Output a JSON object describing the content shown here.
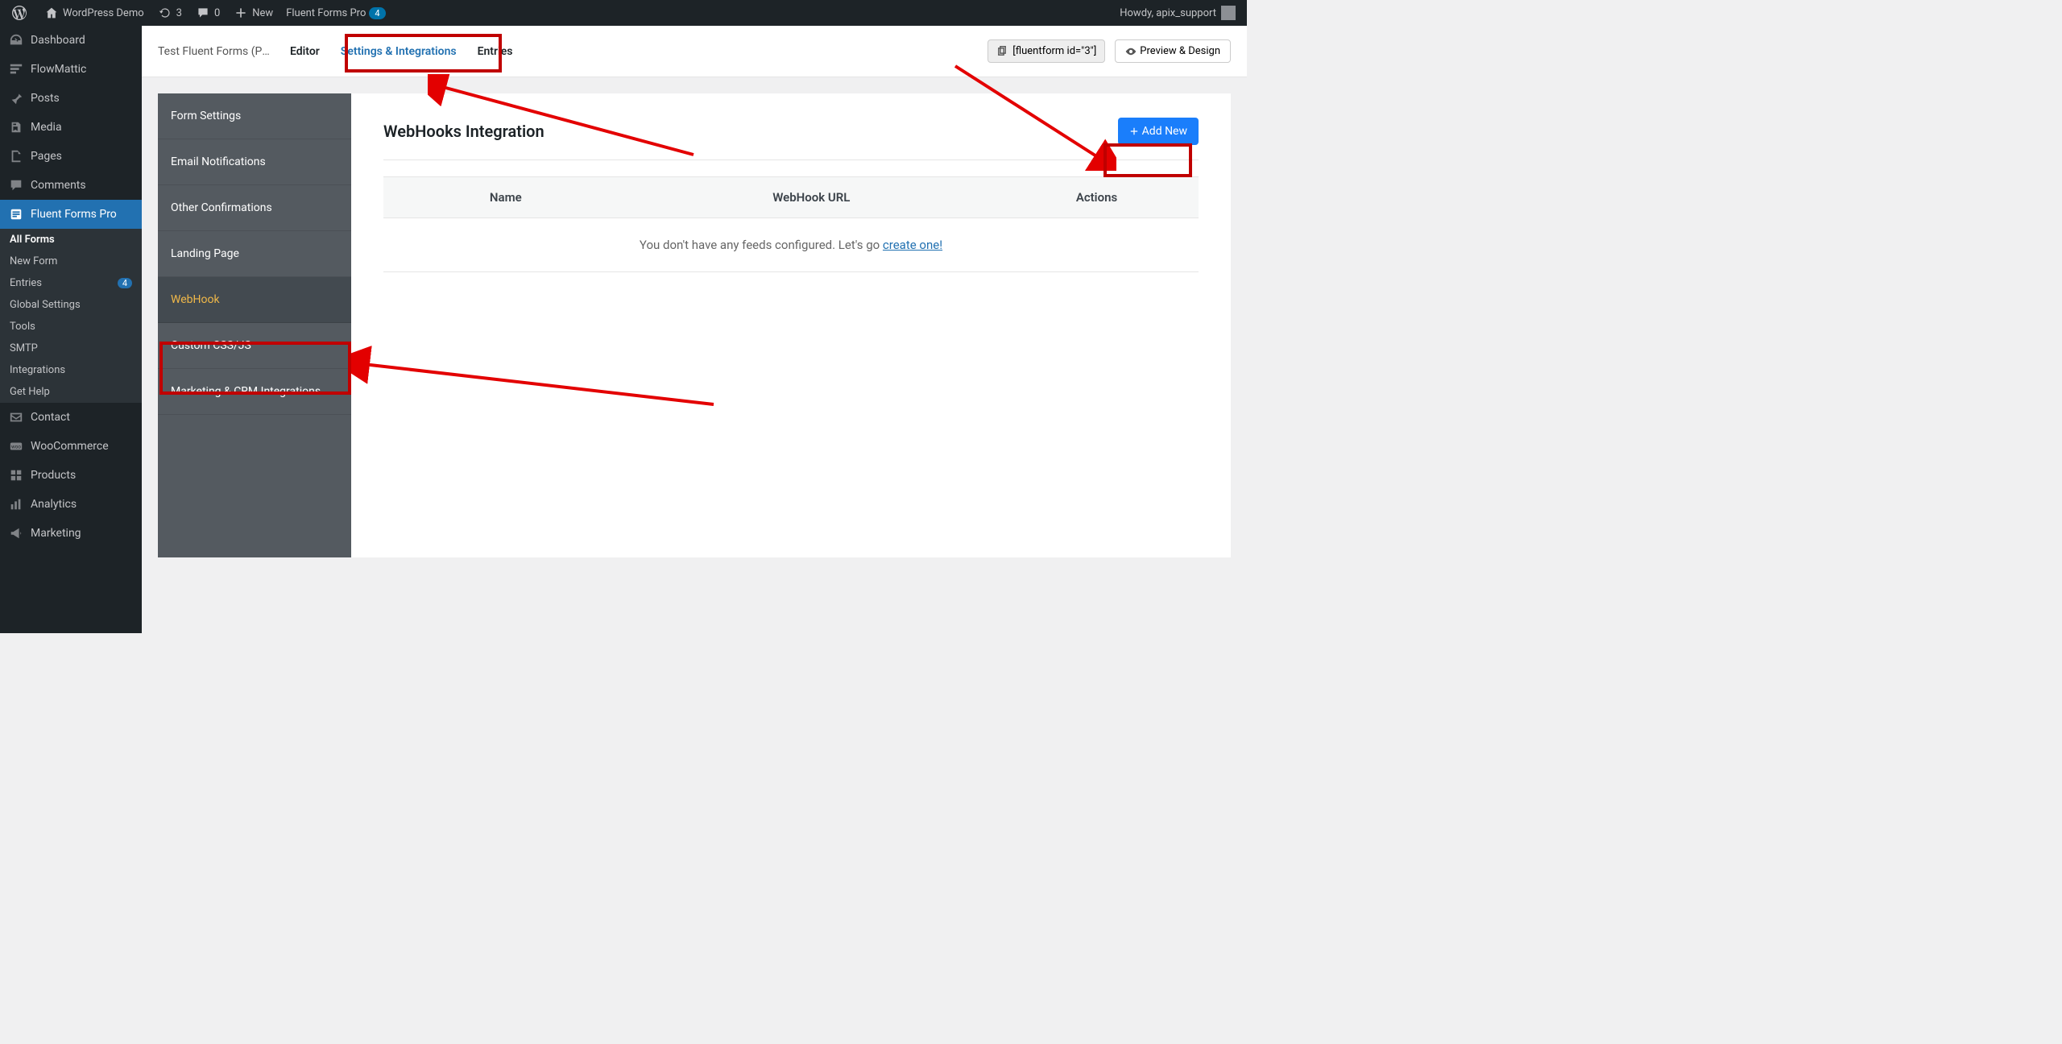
{
  "adminbar": {
    "site_name": "WordPress Demo",
    "updates": "3",
    "comments": "0",
    "new": "New",
    "ff_label": "Fluent Forms Pro",
    "ff_badge": "4",
    "howdy": "Howdy, apix_support"
  },
  "adminmenu": {
    "dashboard": "Dashboard",
    "flowmattic": "FlowMattic",
    "posts": "Posts",
    "media": "Media",
    "pages": "Pages",
    "comments": "Comments",
    "fluentforms": "Fluent Forms Pro",
    "contact": "Contact",
    "woocommerce": "WooCommerce",
    "products": "Products",
    "analytics": "Analytics",
    "marketing": "Marketing"
  },
  "ff_submenu": {
    "all_forms": "All Forms",
    "new_form": "New Form",
    "entries": "Entries",
    "entries_count": "4",
    "global_settings": "Global Settings",
    "tools": "Tools",
    "smtp": "SMTP",
    "integrations": "Integrations",
    "get_help": "Get Help"
  },
  "form_header": {
    "form_title": "Test Fluent Forms (Pr...",
    "editor": "Editor",
    "settings": "Settings & Integrations",
    "entries": "Entries",
    "shortcode": "[fluentform id=\"3\"]",
    "preview": "Preview & Design"
  },
  "settings_sidebar": {
    "form_settings": "Form Settings",
    "email_notifications": "Email Notifications",
    "other_confirmations": "Other Confirmations",
    "landing_page": "Landing Page",
    "webhook": "WebHook",
    "custom_css": "Custom CSS/JS",
    "marketing_crm": "Marketing & CRM Integrations"
  },
  "webhook_panel": {
    "title": "WebHooks Integration",
    "add_new": "Add New",
    "col_name": "Name",
    "col_url": "WebHook URL",
    "col_actions": "Actions",
    "empty_prefix": "You don't have any feeds configured. Let's go ",
    "empty_link": "create one!"
  }
}
